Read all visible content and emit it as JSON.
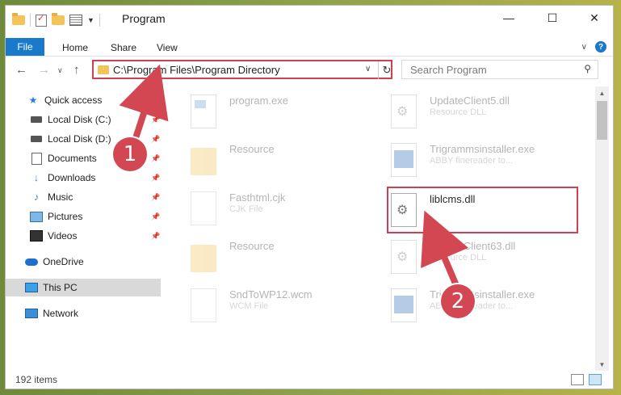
{
  "window": {
    "title": "Program",
    "controls": {
      "minimize": "—",
      "maximize": "☐",
      "close": "✕"
    }
  },
  "ribbon": {
    "tabs": [
      "File",
      "Home",
      "Share",
      "View"
    ]
  },
  "nav": {
    "address": "C:\\Program Files\\Program Directory",
    "search_placeholder": "Search Program"
  },
  "sidebar": {
    "items": [
      {
        "label": "Quick access",
        "icon": "star-icon"
      },
      {
        "label": "Local Disk (C:)",
        "icon": "drive-icon",
        "pinned": true
      },
      {
        "label": "Local Disk (D:)",
        "icon": "drive-icon",
        "pinned": true
      },
      {
        "label": "Documents",
        "icon": "documents-icon",
        "pinned": true
      },
      {
        "label": "Downloads",
        "icon": "downloads-icon",
        "pinned": true
      },
      {
        "label": "Music",
        "icon": "music-icon",
        "pinned": true
      },
      {
        "label": "Pictures",
        "icon": "pictures-icon",
        "pinned": true
      },
      {
        "label": "Videos",
        "icon": "videos-icon",
        "pinned": true
      },
      {
        "label": "OneDrive",
        "icon": "cloud-icon"
      },
      {
        "label": "This PC",
        "icon": "pc-icon",
        "selected": true
      },
      {
        "label": "Network",
        "icon": "network-icon"
      }
    ]
  },
  "files": [
    {
      "name": "program.exe",
      "desc": "",
      "icon": "exe-icon",
      "highlighted": false
    },
    {
      "name": "UpdateClient5.dll",
      "desc": "Resource DLL",
      "icon": "dll-icon",
      "highlighted": false
    },
    {
      "name": "Resource",
      "desc": "",
      "icon": "folder-icon",
      "highlighted": false
    },
    {
      "name": "Trigrammsinstaller.exe",
      "desc": "ABBY finereader to...",
      "icon": "installer-icon",
      "highlighted": false
    },
    {
      "name": "Fasthtml.cjk",
      "desc": "CJK File",
      "icon": "doc-icon",
      "highlighted": false
    },
    {
      "name": "liblcms.dll",
      "desc": "",
      "icon": "dll-icon",
      "highlighted": true
    },
    {
      "name": "Resource",
      "desc": "",
      "icon": "folder-icon",
      "highlighted": false
    },
    {
      "name": "UpdateClient63.dll",
      "desc": "Resource DLL",
      "icon": "dll-icon",
      "highlighted": false
    },
    {
      "name": "SndToWP12.wcm",
      "desc": "WCM File",
      "icon": "doc-icon",
      "highlighted": false
    },
    {
      "name": "Trigrammsinstaller.exe",
      "desc": "ABBY finereader to...",
      "icon": "installer-icon",
      "highlighted": false
    }
  ],
  "status": {
    "item_count": "192 items"
  },
  "callouts": [
    {
      "number": "1"
    },
    {
      "number": "2"
    }
  ],
  "colors": {
    "accent": "#1979ca",
    "callout": "#d24752",
    "highlight_border": "#d04050"
  }
}
